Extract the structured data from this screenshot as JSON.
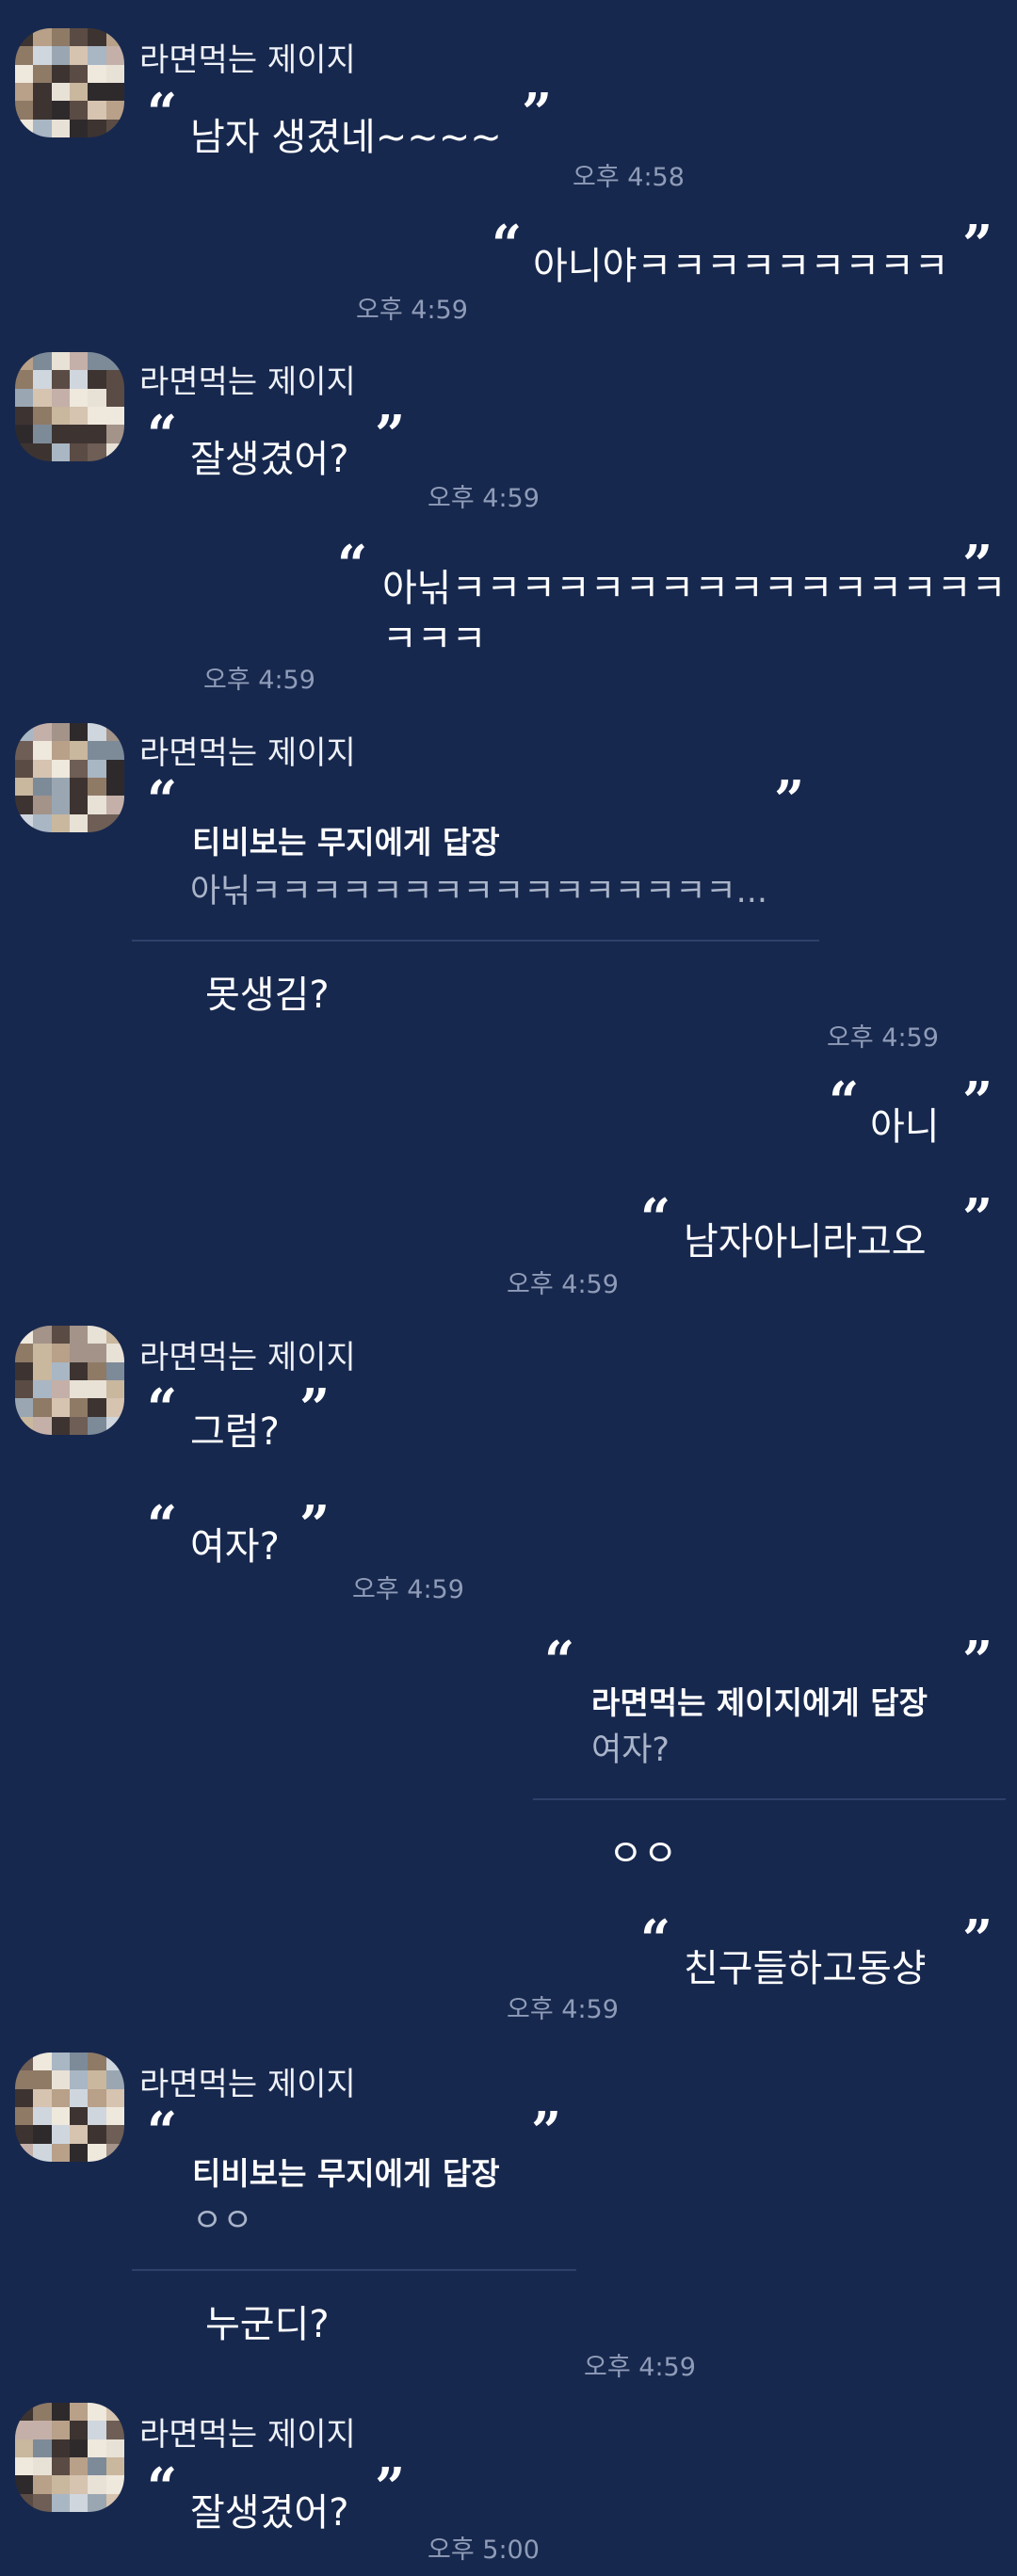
{
  "other_user": {
    "name": "라면먹는 제이지"
  },
  "messages": [
    {
      "id": "m1",
      "text": "남자 생겼네~~~~",
      "time": "오후 4:58"
    },
    {
      "id": "m2",
      "text": "아니야ㅋㅋㅋㅋㅋㅋㅋㅋㅋ",
      "time": "오후 4:59"
    },
    {
      "id": "m3",
      "text": "잘생겼어?",
      "time": "오후 4:59"
    },
    {
      "id": "m4",
      "line1": "아닊ㅋㅋㅋㅋㅋㅋㅋㅋㅋㅋㅋㅋㅋㅋㅋㅋ",
      "line2": "ㅋㅋㅋ",
      "time": "오후 4:59"
    },
    {
      "id": "m5",
      "reply_header": "티비보는 무지에게 답장",
      "reply_quote": "아닊ㅋㅋㅋㅋㅋㅋㅋㅋㅋㅋㅋㅋㅋㅋㅋㅋ...",
      "text": "못생김?",
      "time": "오후 4:59"
    },
    {
      "id": "m6",
      "text": "아니"
    },
    {
      "id": "m7",
      "text": "남자아니라고오",
      "time": "오후 4:59"
    },
    {
      "id": "m8",
      "text": "그럼?"
    },
    {
      "id": "m9",
      "text": "여자?",
      "time": "오후 4:59"
    },
    {
      "id": "m10",
      "reply_header": "라면먹는 제이지에게 답장",
      "reply_quote": "여자?",
      "text": "ㅇㅇ"
    },
    {
      "id": "m11",
      "text": "친구들하고동샹",
      "time": "오후 4:59"
    },
    {
      "id": "m12",
      "reply_header": "티비보는 무지에게 답장",
      "reply_quote": "ㅇㅇ",
      "text": "누군디?",
      "time": "오후 4:59"
    },
    {
      "id": "m13",
      "text": "잘생겼어?",
      "time": "오후 5:00"
    }
  ],
  "icons": {
    "open_quote": "quote-open-icon",
    "close_quote": "quote-close-icon",
    "avatar": "pixelated-avatar"
  },
  "quote_glyphs": {
    "open": "“",
    "close": "”"
  },
  "colors": {
    "background": "#17284e",
    "text": "#ffffff",
    "time": "#8f9cb8",
    "divider": "#2f406a",
    "reply_quote": "#aab4c9"
  }
}
